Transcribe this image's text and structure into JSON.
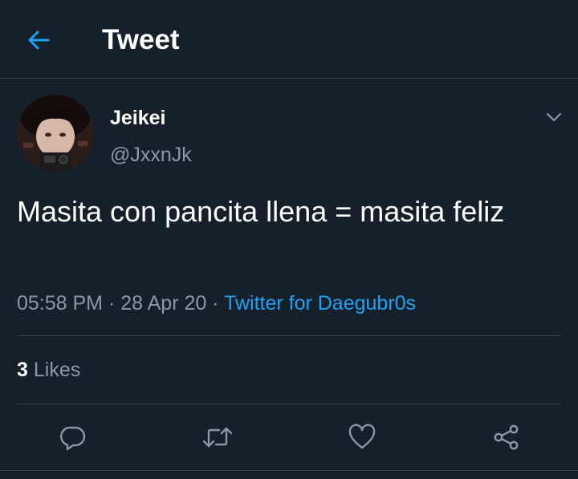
{
  "header": {
    "title": "Tweet",
    "back_icon": "arrow-left-icon"
  },
  "tweet": {
    "author": {
      "display_name": "Jeikei",
      "handle": "@JxxnJk"
    },
    "text": "Masita con pancita llena = masita feliz",
    "time": "05:58 PM",
    "separator": "·",
    "date": "28 Apr 20",
    "source": "Twitter for Daegubr0s",
    "likes": {
      "count": "3",
      "label": "Likes"
    }
  },
  "actions": [
    {
      "name": "reply",
      "icon": "reply-icon"
    },
    {
      "name": "retweet",
      "icon": "retweet-icon"
    },
    {
      "name": "like",
      "icon": "heart-icon"
    },
    {
      "name": "share",
      "icon": "share-icon"
    }
  ],
  "colors": {
    "background": "#15202b",
    "accent": "#1da1f2",
    "secondary_text": "#8899a6",
    "divider": "#38444d"
  }
}
